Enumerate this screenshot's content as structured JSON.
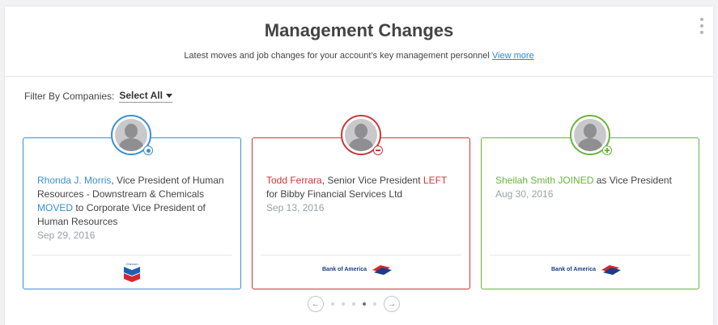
{
  "header": {
    "title": "Management Changes",
    "subtitle": "Latest moves and job changes for your account's key management personnel",
    "view_more": "View more"
  },
  "filter": {
    "label": "Filter By Companies:",
    "selected": "Select All"
  },
  "colors": {
    "moved": "#3a8fd3",
    "left": "#c9383a",
    "joined": "#6bb33c"
  },
  "cards": [
    {
      "type": "moved",
      "name": "Rhonda J. Morris",
      "text_before": ", Vice President of Human Resources - Downstream & Chemicals ",
      "action": "MOVED",
      "text_after": " to Corporate Vice President of Human Resources",
      "date": "Sep 29, 2016",
      "badge_icon": "dot-badge-icon",
      "logo": "Chevron"
    },
    {
      "type": "left",
      "name": "Todd Ferrara",
      "text_before": ", Senior Vice President ",
      "action": "LEFT",
      "text_after": " for Bibby Financial Services Ltd",
      "date": "Sep 13, 2016",
      "badge_icon": "minus-badge-icon",
      "logo": "Bank of America"
    },
    {
      "type": "joined",
      "name": "Sheilah Smith",
      "text_before": " ",
      "action": "JOINED",
      "text_after": " as Vice President",
      "date": "Aug 30, 2016",
      "badge_icon": "plus-badge-icon",
      "logo": "Bank of America"
    }
  ],
  "pager": {
    "prev_icon": "arrow-left-icon",
    "next_icon": "arrow-right-icon",
    "dot_count": 5,
    "active_dot": 4
  }
}
